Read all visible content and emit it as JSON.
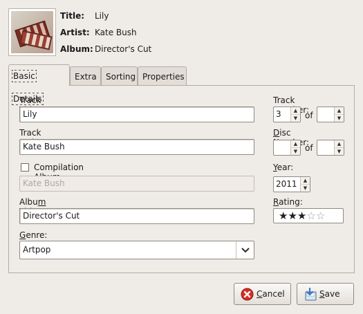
{
  "header": {
    "title_key": "Title:",
    "title_value": "Lily",
    "artist_key": "Artist:",
    "artist_value": "Kate Bush",
    "album_key": "Album:",
    "album_value": "Director's Cut"
  },
  "tabs": [
    {
      "label": "Basic Details",
      "active": true
    },
    {
      "label": "Extra",
      "active": false
    },
    {
      "label": "Sorting",
      "active": false
    },
    {
      "label": "Properties",
      "active": false
    }
  ],
  "basic": {
    "track_title_label": "Track Title:",
    "track_title_value": "Lily",
    "track_artist_label": "Track Artist:",
    "track_artist_value": "Kate Bush",
    "compilation_label": "Compilation Album Artist:",
    "compilation_checked": false,
    "album_artist_value": "Kate Bush",
    "album_title_label": "Album Title:",
    "album_title_value": "Director's Cut",
    "genre_label": "Genre:",
    "genre_value": "Artpop",
    "track_number_label": "Track Number:",
    "track_number_value": "3",
    "of_label": "of",
    "track_total_value": "",
    "disc_number_label": "Disc Number:",
    "disc_number_value": "",
    "disc_total_value": "",
    "year_label": "Year:",
    "year_value": "2011",
    "rating_label": "Rating:",
    "rating_value": 3,
    "rating_max": 5
  },
  "buttons": {
    "cancel_label": "Cancel",
    "save_label": "Save"
  },
  "colors": {
    "window_bg": "#efebe7",
    "cancel_icon": "#d62e24",
    "save_icon": "#3a78c2"
  },
  "icons": {
    "cancel": "cancel-icon",
    "save": "save-icon",
    "genre_dropdown": "chevron-down-icon"
  }
}
